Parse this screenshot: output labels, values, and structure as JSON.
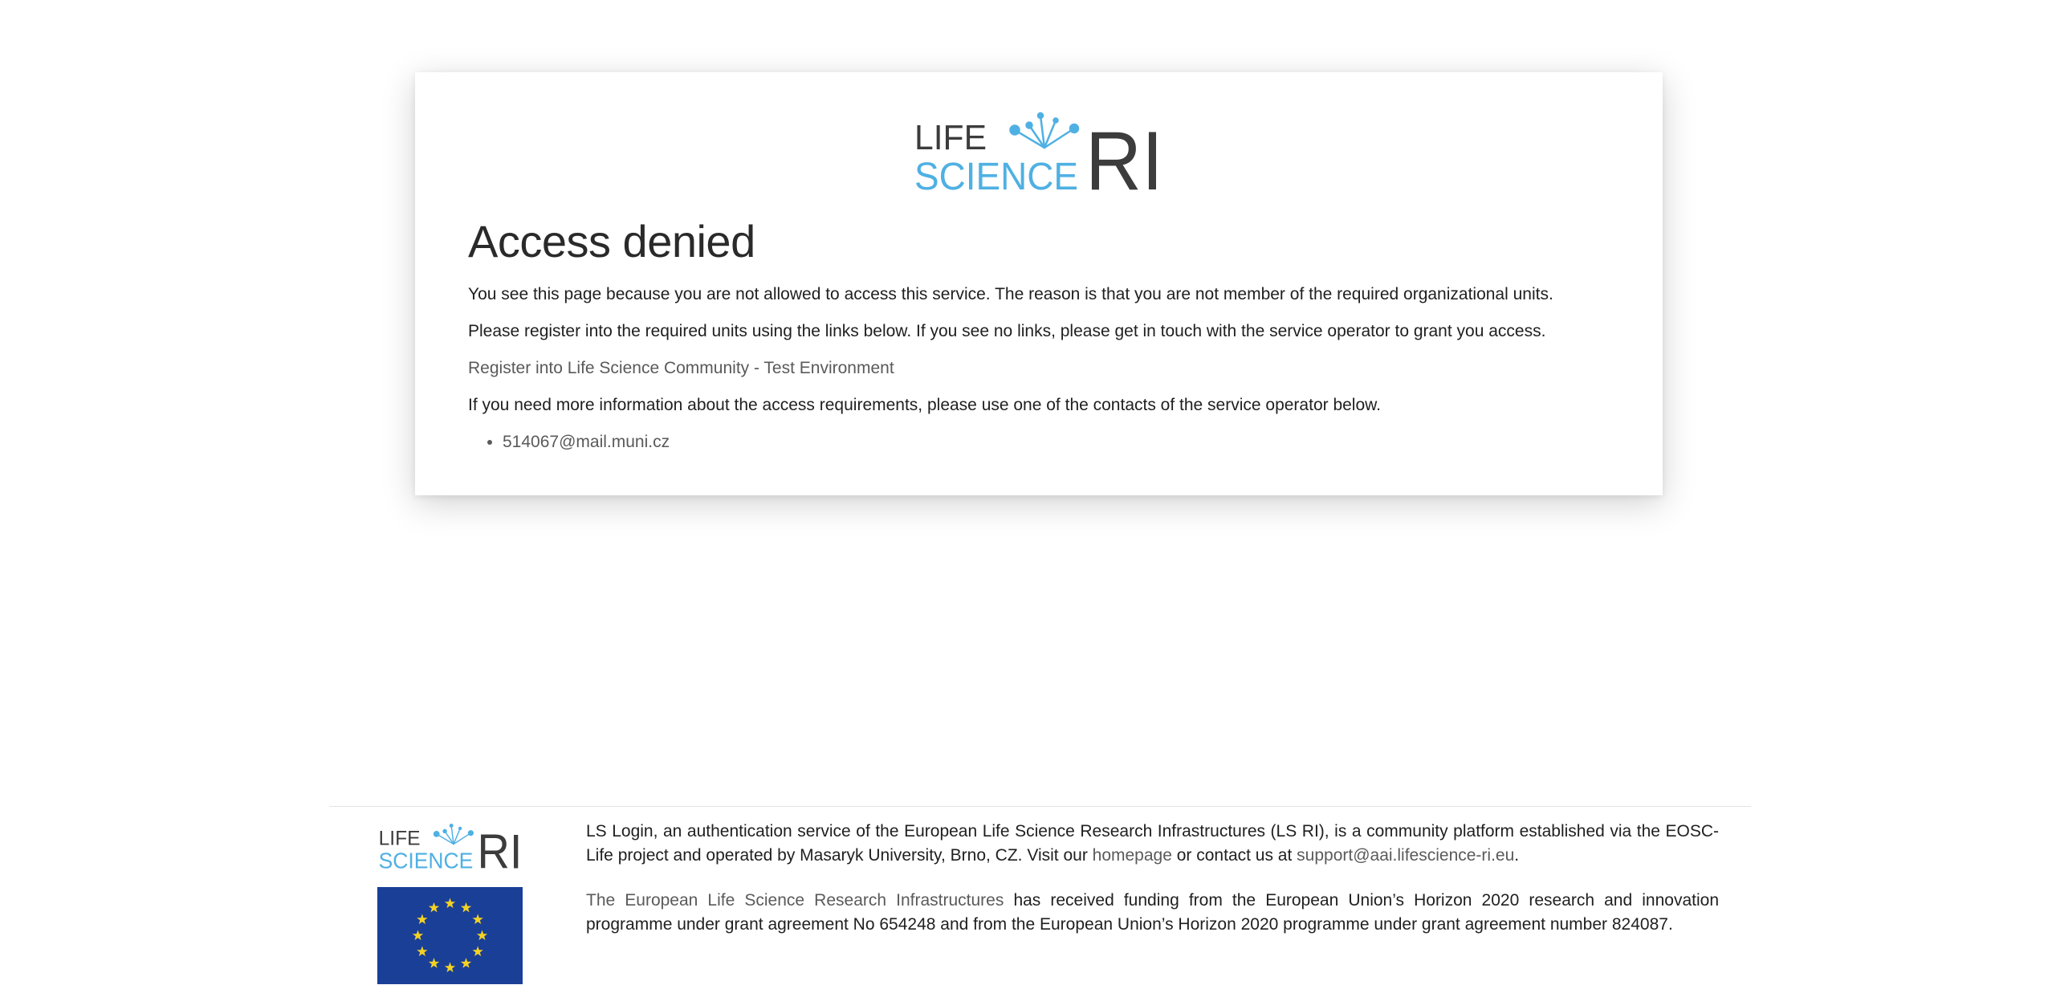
{
  "brand": {
    "logo_line1": "LIFE",
    "logo_line2": "SCIENCE",
    "logo_suffix": "RI",
    "color_dark": "#3d3c3c",
    "color_accent": "#4fb0e3"
  },
  "main": {
    "title": "Access denied",
    "paragraph1": "You see this page because you are not allowed to access this service. The reason is that you are not member of the required organizational units.",
    "paragraph2": "Please register into the required units using the links below. If you see no links, please get in touch with the service operator to grant you access.",
    "register_link": "Register into Life Science Community - Test Environment",
    "paragraph3": "If you need more information about the access requirements, please use one of the contacts of the service operator below.",
    "contacts": [
      "514067@mail.muni.cz"
    ]
  },
  "footer": {
    "line1_before": "LS Login, an authentication service of the European Life Science Research Infrastructures (LS RI), is a community platform established via the EOSC-Life project and operated by Masaryk University, Brno, CZ. Visit our ",
    "homepage_link": "homepage",
    "line1_middle": " or contact us at ",
    "support_link": "support@aai.lifescience-ri.eu",
    "line1_end": ".",
    "funding_link": "The European Life Science Research Infrastructures",
    "funding_text": " has received funding from the European Union’s Horizon 2020 research and innovation programme under grant agreement No 654248 and from the European Union’s Horizon 2020 programme under grant agreement number 824087.",
    "eu_flag_color": "#1a3f97",
    "eu_star_color": "#f4d223"
  }
}
